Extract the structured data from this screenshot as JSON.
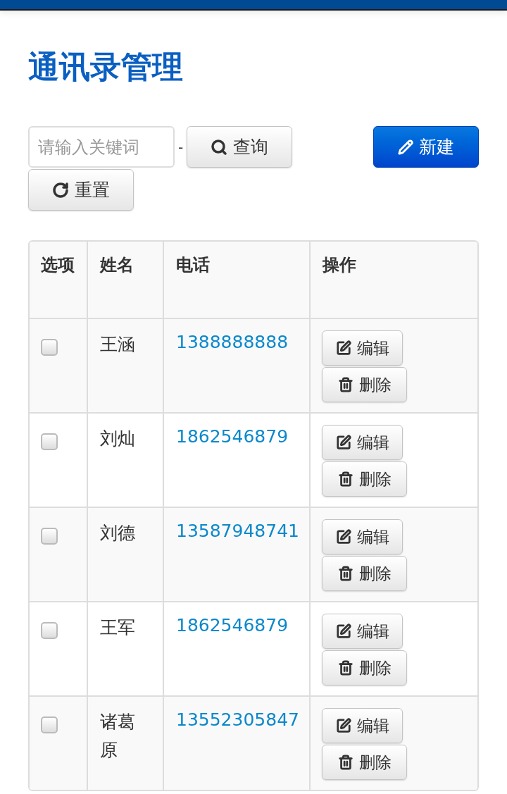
{
  "title": "通讯录管理",
  "toolbar": {
    "search": {
      "placeholder": "请输入关键词"
    },
    "separator": "-",
    "query_button": "查询",
    "reset_button": "重置",
    "new_button": "新建"
  },
  "table": {
    "columns": [
      "选项",
      "姓名",
      "电话",
      "操作"
    ],
    "rows": [
      {
        "checked": false,
        "name": "王涵",
        "phone": "1388888888",
        "edit": "编辑",
        "delete": "删除"
      },
      {
        "checked": false,
        "name": "刘灿",
        "phone": "1862546879",
        "edit": "编辑",
        "delete": "删除"
      },
      {
        "checked": false,
        "name": "刘德",
        "phone": "13587948741",
        "edit": "编辑",
        "delete": "删除"
      },
      {
        "checked": false,
        "name": "王军",
        "phone": "1862546879",
        "edit": "编辑",
        "delete": "删除"
      },
      {
        "checked": false,
        "name": "诸葛原",
        "phone": "13552305847",
        "edit": "编辑",
        "delete": "删除"
      }
    ]
  }
}
